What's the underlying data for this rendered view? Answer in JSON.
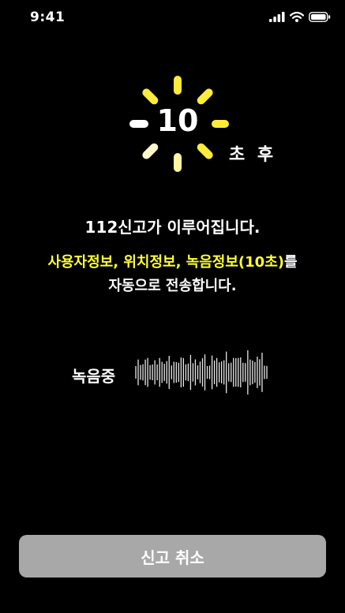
{
  "status_bar": {
    "time": "9:41",
    "icons": [
      "cellular-signal-icon",
      "wifi-icon",
      "battery-icon"
    ]
  },
  "countdown": {
    "seconds": "10",
    "after_label": "초 후",
    "spinner_color": "#ffeb3b"
  },
  "message": {
    "headline": "112신고가 이루어집니다.",
    "info_highlight": "사용자정보, 위치정보, 녹음정보(10초)",
    "info_suffix": "를",
    "info_line2": "자동으로 전송합니다."
  },
  "recording": {
    "label": "녹음중"
  },
  "cancel_button": {
    "label": "신고 취소"
  },
  "colors": {
    "background": "#000000",
    "accent": "#ffff33",
    "button": "#a8a8a8"
  }
}
